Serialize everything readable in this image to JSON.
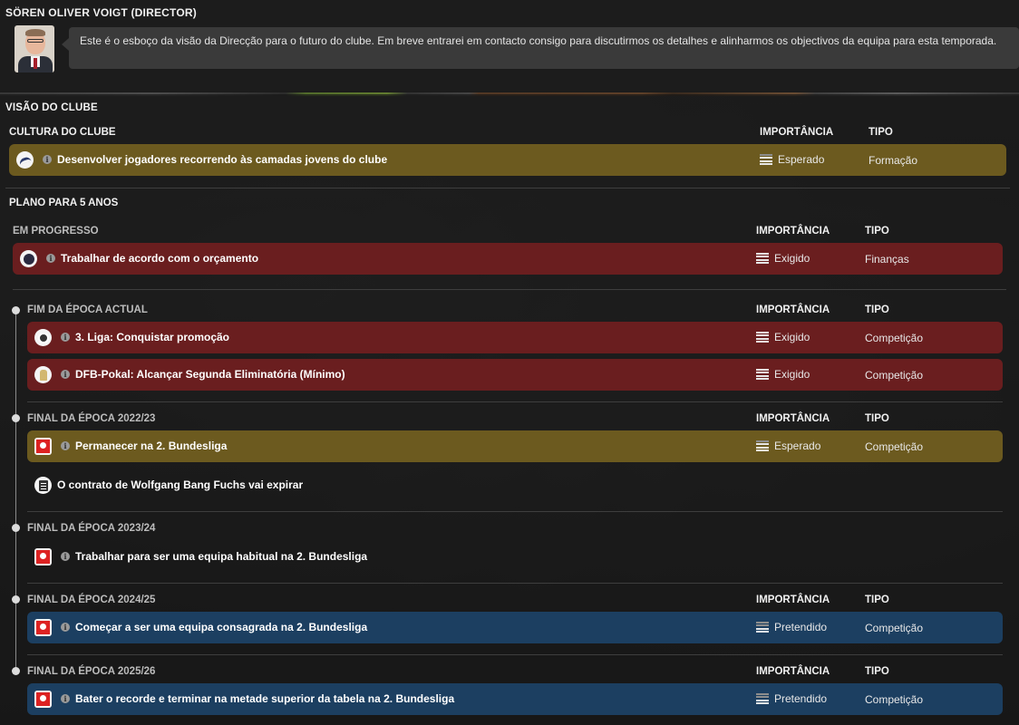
{
  "director": {
    "name": "SÖREN OLIVER VOIGT (DIRECTOR)",
    "message": "Este é o esboço da visão da Direcção para o futuro do clube. Em breve entrarei em contacto consigo para discutirmos os detalhes e alinharmos os objectivos da equipa para esta temporada."
  },
  "vision": {
    "title": "VISÃO DO CLUBE",
    "culture": {
      "title": "CULTURA DO CLUBE",
      "col_importance": "IMPORTÂNCIA",
      "col_type": "TIPO",
      "items": [
        {
          "label": "Desenvolver jogadores recorrendo às camadas jovens do clube",
          "importance": "Esperado",
          "type": "Formação",
          "icon": "club-swoosh-icon"
        }
      ]
    },
    "plan": {
      "title": "PLANO PARA 5 ANOS",
      "in_progress": {
        "title": "EM PROGRESSO",
        "col_importance": "IMPORTÂNCIA",
        "col_type": "TIPO",
        "items": [
          {
            "label": "Trabalhar de acordo com o orçamento",
            "importance": "Exigido",
            "type": "Finanças",
            "icon": "finance-badge-icon"
          }
        ]
      },
      "season_end": {
        "title": "FIM DA ÉPOCA ACTUAL",
        "col_importance": "IMPORTÂNCIA",
        "col_type": "TIPO",
        "items": [
          {
            "label": "3. Liga: Conquistar promoção",
            "importance": "Exigido",
            "type": "Competição",
            "icon": "liga3-ball-icon"
          },
          {
            "label": "DFB-Pokal: Alcançar Segunda Eliminatória (Mínimo)",
            "importance": "Exigido",
            "type": "Competição",
            "icon": "dfb-pokal-cup-icon"
          }
        ]
      },
      "s2223": {
        "title": "FINAL DA ÉPOCA 2022/23",
        "col_importance": "IMPORTÂNCIA",
        "col_type": "TIPO",
        "items": [
          {
            "label": "Permanecer na 2. Bundesliga",
            "importance": "Esperado",
            "type": "Competição",
            "icon": "bundesliga2-icon"
          },
          {
            "label": "O contrato de Wolfgang Bang Fuchs vai expirar",
            "icon": "contract-document-icon"
          }
        ]
      },
      "s2324": {
        "title": "FINAL DA ÉPOCA 2023/24",
        "items": [
          {
            "label": "Trabalhar para ser uma equipa habitual na 2. Bundesliga",
            "icon": "bundesliga2-icon"
          }
        ]
      },
      "s2425": {
        "title": "FINAL DA ÉPOCA 2024/25",
        "col_importance": "IMPORTÂNCIA",
        "col_type": "TIPO",
        "items": [
          {
            "label": "Começar a ser uma equipa consagrada na 2. Bundesliga",
            "importance": "Pretendido",
            "type": "Competição",
            "icon": "bundesliga2-icon"
          }
        ]
      },
      "s2526": {
        "title": "FINAL DA ÉPOCA 2025/26",
        "col_importance": "IMPORTÂNCIA",
        "col_type": "TIPO",
        "items": [
          {
            "label": "Bater o recorde e terminar na metade superior da tabela na 2. Bundesliga",
            "importance": "Pretendido",
            "type": "Competição",
            "icon": "bundesliga2-icon"
          }
        ]
      }
    }
  },
  "colors": {
    "expected": "#6c5a1f",
    "required": "#6a1e1f",
    "intended": "#1c3f61"
  }
}
